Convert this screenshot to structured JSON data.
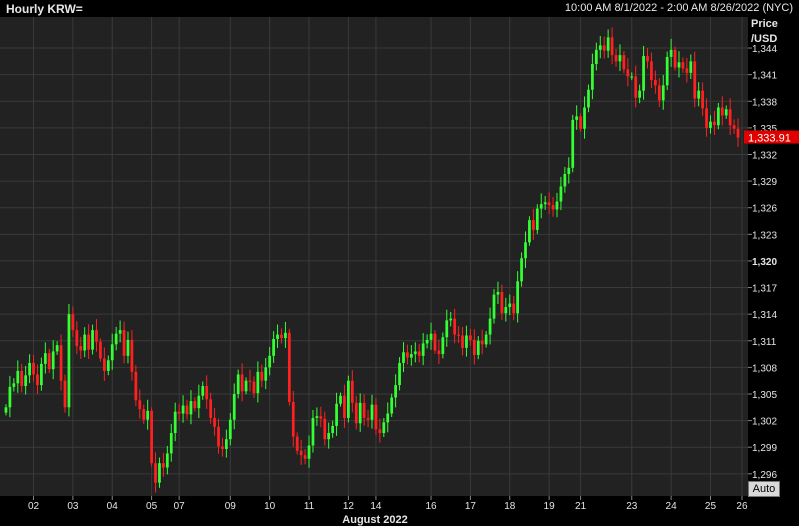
{
  "header": {
    "title": "Hourly KRW=",
    "range": "10:00 AM 8/1/2022 - 2:00 AM 8/26/2022 (NYC)"
  },
  "axis": {
    "price_label_line1": "Price",
    "price_label_line2": "/USD",
    "month_label": "August 2022",
    "auto_label": "Auto"
  },
  "last_price_label": "1,333.91",
  "colors": {
    "up": "#33ff33",
    "down": "#ff2020",
    "background": "#222222",
    "grid": "#3a3a3a",
    "last_price_bg": "#e00000"
  },
  "chart_data": {
    "type": "candlestick",
    "title": "",
    "xlabel": "August 2022",
    "ylabel": "Price /USD",
    "ylim": [
      1293.5,
      1347.5
    ],
    "y_ticks": [
      {
        "value": 1344,
        "label": "1,344"
      },
      {
        "value": 1341,
        "label": "1,341"
      },
      {
        "value": 1338,
        "label": "1,338"
      },
      {
        "value": 1335,
        "label": "1,335"
      },
      {
        "value": 1332,
        "label": "1,332"
      },
      {
        "value": 1329,
        "label": "1,329"
      },
      {
        "value": 1326,
        "label": "1,326"
      },
      {
        "value": 1323,
        "label": "1,323"
      },
      {
        "value": 1320,
        "label": "1,320",
        "bold": true
      },
      {
        "value": 1317,
        "label": "1,317"
      },
      {
        "value": 1314,
        "label": "1,314"
      },
      {
        "value": 1311,
        "label": "1,311"
      },
      {
        "value": 1308,
        "label": "1,308"
      },
      {
        "value": 1305,
        "label": "1,305"
      },
      {
        "value": 1302,
        "label": "1,302"
      },
      {
        "value": 1299,
        "label": "1,299"
      },
      {
        "value": 1296,
        "label": "1,296"
      }
    ],
    "x_ticks": [
      {
        "label": "02",
        "index": 7
      },
      {
        "label": "03",
        "index": 17
      },
      {
        "label": "04",
        "index": 27
      },
      {
        "label": "05",
        "index": 37
      },
      {
        "label": "07",
        "index": 44
      },
      {
        "label": "09",
        "index": 57
      },
      {
        "label": "10",
        "index": 67
      },
      {
        "label": "11",
        "index": 77
      },
      {
        "label": "12",
        "index": 87
      },
      {
        "label": "14",
        "index": 94
      },
      {
        "label": "16",
        "index": 108
      },
      {
        "label": "17",
        "index": 118
      },
      {
        "label": "18",
        "index": 128
      },
      {
        "label": "19",
        "index": 138
      },
      {
        "label": "21",
        "index": 146
      },
      {
        "label": "23",
        "index": 159
      },
      {
        "label": "24",
        "index": 169
      },
      {
        "label": "25",
        "index": 179
      },
      {
        "label": "26",
        "index": 187
      }
    ],
    "last_price": 1333.91,
    "closes": [
      1303.5,
      1305.8,
      1306.2,
      1307.6,
      1305.9,
      1307.1,
      1308.5,
      1307.2,
      1306,
      1308.4,
      1309.6,
      1307.8,
      1309.8,
      1310.5,
      1306.5,
      1303.5,
      1314,
      1312.2,
      1310.4,
      1309.9,
      1311.7,
      1310,
      1312.2,
      1310.9,
      1309,
      1307.6,
      1308.8,
      1310.6,
      1311.8,
      1312.2,
      1309.3,
      1311.1,
      1307.5,
      1304.3,
      1303.3,
      1302.1,
      1303.1,
      1297.2,
      1295,
      1297.2,
      1296.7,
      1298.3,
      1300.6,
      1303,
      1302.8,
      1303.7,
      1302.7,
      1304.2,
      1303.4,
      1304.8,
      1305.9,
      1304.4,
      1302.3,
      1301.3,
      1299.1,
      1298.8,
      1299.9,
      1302.1,
      1305,
      1307.2,
      1305.3,
      1306.5,
      1306.4,
      1305.1,
      1307.5,
      1306.5,
      1308,
      1309.3,
      1311.2,
      1311.7,
      1311.3,
      1311.9,
      1304.1,
      1300.2,
      1298.6,
      1298.1,
      1297.7,
      1299.2,
      1302.3,
      1302.5,
      1302.2,
      1299.9,
      1300.6,
      1301.4,
      1303.9,
      1304.8,
      1302.3,
      1306.5,
      1304,
      1301.7,
      1304,
      1302.3,
      1302.1,
      1303.8,
      1301,
      1300.6,
      1301.8,
      1302.8,
      1304.6,
      1306,
      1308.5,
      1309.7,
      1309.1,
      1309.5,
      1309.8,
      1309.3,
      1310.7,
      1311.1,
      1311.8,
      1309.9,
      1309.5,
      1311.4,
      1313.3,
      1313.5,
      1311.7,
      1311.6,
      1310.2,
      1311.6,
      1311.1,
      1309.4,
      1311,
      1310.6,
      1311.7,
      1313.5,
      1316.2,
      1316.5,
      1314.1,
      1314.8,
      1315.2,
      1314.1,
      1317.7,
      1320.3,
      1322.1,
      1324.6,
      1323.5,
      1325.9,
      1326.4,
      1326.6,
      1326.3,
      1325.8,
      1326.7,
      1328.4,
      1329.8,
      1330.5,
      1335.9,
      1336.3,
      1334.9,
      1337.3,
      1339.3,
      1342.2,
      1343.8,
      1344.3,
      1343.7,
      1345.2,
      1343.2,
      1342.5,
      1343.2,
      1341.6,
      1340.8,
      1340.8,
      1338.4,
      1339.2,
      1343.1,
      1342.5,
      1340.4,
      1339.8,
      1338.1,
      1339.8,
      1343,
      1343.8,
      1341.8,
      1342.4,
      1341.7,
      1341.2,
      1342.5,
      1338.3,
      1339.2,
      1337.2,
      1335,
      1335.7,
      1335.3,
      1337.3,
      1336.4,
      1337.1,
      1335.3,
      1334.9,
      1333.9
    ],
    "note_values": "Hourly closing prices in KRW per USD, read approximately from the chart, 8/1/2022 10:00 AM to 8/26/2022 2:00 AM."
  }
}
